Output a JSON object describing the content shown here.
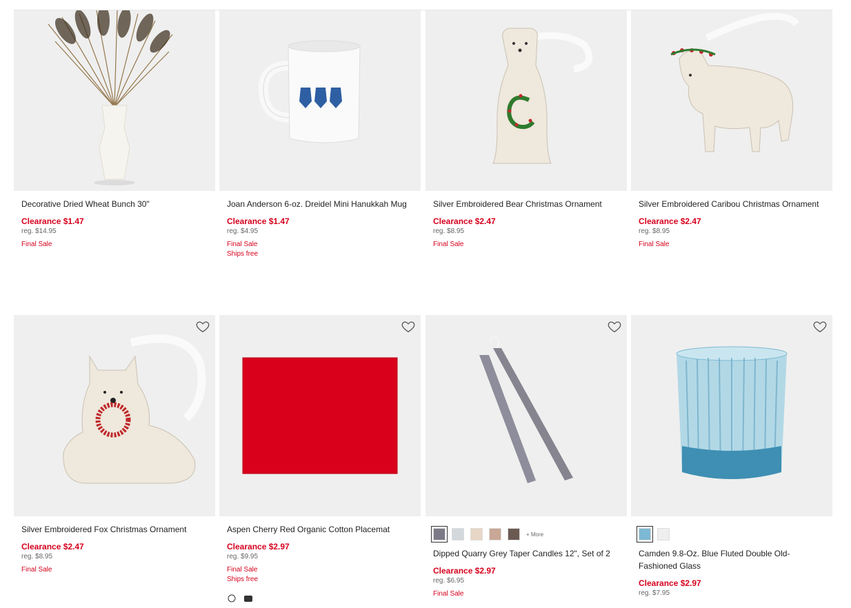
{
  "row1": [
    {
      "name": "Decorative Dried Wheat Bunch 30\"",
      "clearance": "Clearance $1.47",
      "reg": "reg. $14.95",
      "flags": [
        "Final Sale"
      ]
    },
    {
      "name": "Joan Anderson 6-oz. Dreidel Mini Hanukkah Mug",
      "clearance": "Clearance $1.47",
      "reg": "reg. $4.95",
      "flags": [
        "Final Sale",
        "Ships free"
      ]
    },
    {
      "name": "Silver Embroidered Bear Christmas Ornament",
      "clearance": "Clearance $2.47",
      "reg": "reg. $8.95",
      "flags": [
        "Final Sale"
      ]
    },
    {
      "name": "Silver Embroidered Caribou Christmas Ornament",
      "clearance": "Clearance $2.47",
      "reg": "reg. $8.95",
      "flags": [
        "Final Sale"
      ]
    }
  ],
  "row2": [
    {
      "name": "Silver Embroidered Fox Christmas Ornament",
      "clearance": "Clearance $2.47",
      "reg": "reg. $8.95",
      "flags": [
        "Final Sale"
      ]
    },
    {
      "name": "Aspen Cherry Red Organic Cotton Placemat",
      "clearance": "Clearance $2.97",
      "reg": "reg. $9.95",
      "flags": [
        "Final Sale",
        "Ships free"
      ]
    },
    {
      "name": "Dipped Quarry Grey Taper Candles 12\", Set of 2",
      "clearance": "Clearance $2.97",
      "reg": "reg. $6.95",
      "flags": [
        "Final Sale"
      ],
      "swatches": [
        "#7b7a86",
        "#d3d8dc",
        "#e8d7c6",
        "#c9a796",
        "#6b5a52"
      ],
      "more": "+ More"
    },
    {
      "name": "Camden 9.8-Oz. Blue Fluted Double Old-Fashioned Glass",
      "clearance": "Clearance $2.97",
      "reg": "reg. $7.95",
      "flags": [],
      "swatches": [
        "#7db8d4",
        "#eeeeee"
      ]
    }
  ],
  "colors": {
    "clearance": "#d6001c",
    "placemat": "#d8001a"
  },
  "icons": {
    "wishlist": "heart-outline-icon"
  }
}
